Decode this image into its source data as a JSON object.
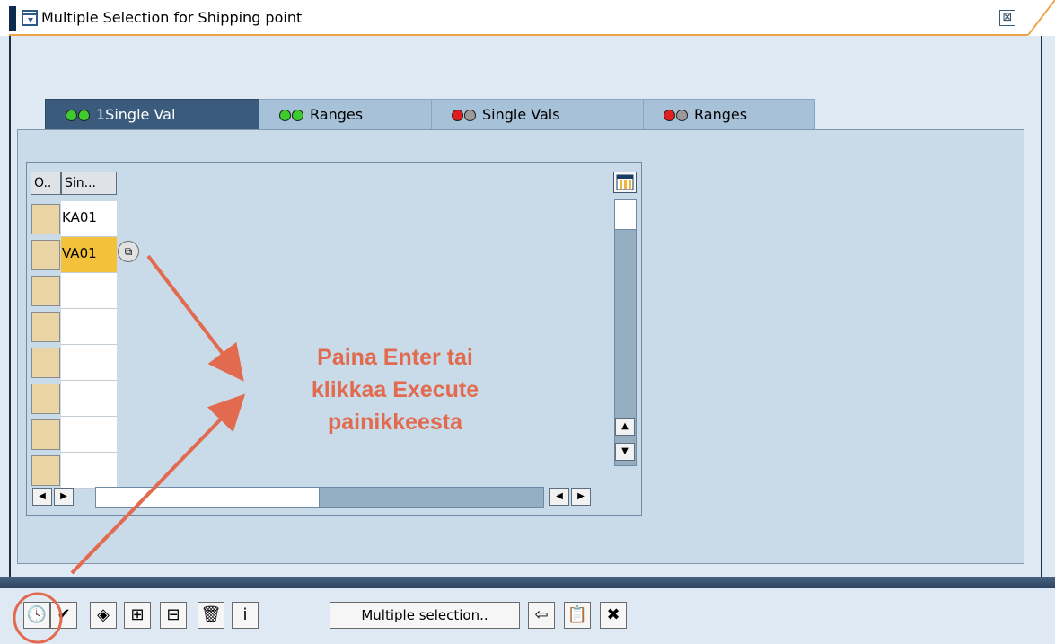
{
  "window": {
    "title": "Multiple Selection for Shipping point",
    "close_glyph": "⊠"
  },
  "tabs": [
    {
      "label": "1Single Val",
      "lights": [
        "#3ecb2e",
        "#3ecb2e"
      ],
      "active": true
    },
    {
      "label": "Ranges",
      "lights": [
        "#3ecb2e",
        "#3ecb2e"
      ],
      "active": false
    },
    {
      "label": "Single Vals",
      "lights": [
        "#e01e1e",
        "#9a9a9a"
      ],
      "active": false
    },
    {
      "label": "Ranges",
      "lights": [
        "#e01e1e",
        "#9a9a9a"
      ],
      "active": false
    }
  ],
  "table": {
    "columns": [
      "O..",
      "Sin..."
    ],
    "rows": [
      "KA01",
      "VA01",
      "",
      "",
      "",
      "",
      "",
      ""
    ],
    "selected_row": 1
  },
  "annotation": {
    "lines": [
      "Paina Enter tai",
      "klikkaa Execute",
      "painikkeesta"
    ],
    "color": "#e26a4f"
  },
  "toolbar": {
    "buttons": [
      {
        "icon": "execute-icon",
        "glyph": "🕓"
      },
      {
        "icon": "checkmark-icon",
        "glyph": "✔"
      },
      {
        "icon": "selection-options-icon",
        "glyph": "◈"
      },
      {
        "icon": "insert-row-icon",
        "glyph": "⊞"
      },
      {
        "icon": "delete-row-icon",
        "glyph": "⊟"
      },
      {
        "icon": "trash-icon",
        "glyph": "🗑"
      },
      {
        "icon": "info-icon",
        "glyph": "i"
      }
    ],
    "multiple_selection_label": "Multiple selection..",
    "buttons_right": [
      {
        "icon": "import-icon",
        "glyph": "⇦"
      },
      {
        "icon": "paste-icon",
        "glyph": "📋"
      },
      {
        "icon": "cancel-icon",
        "glyph": "✖"
      }
    ]
  }
}
